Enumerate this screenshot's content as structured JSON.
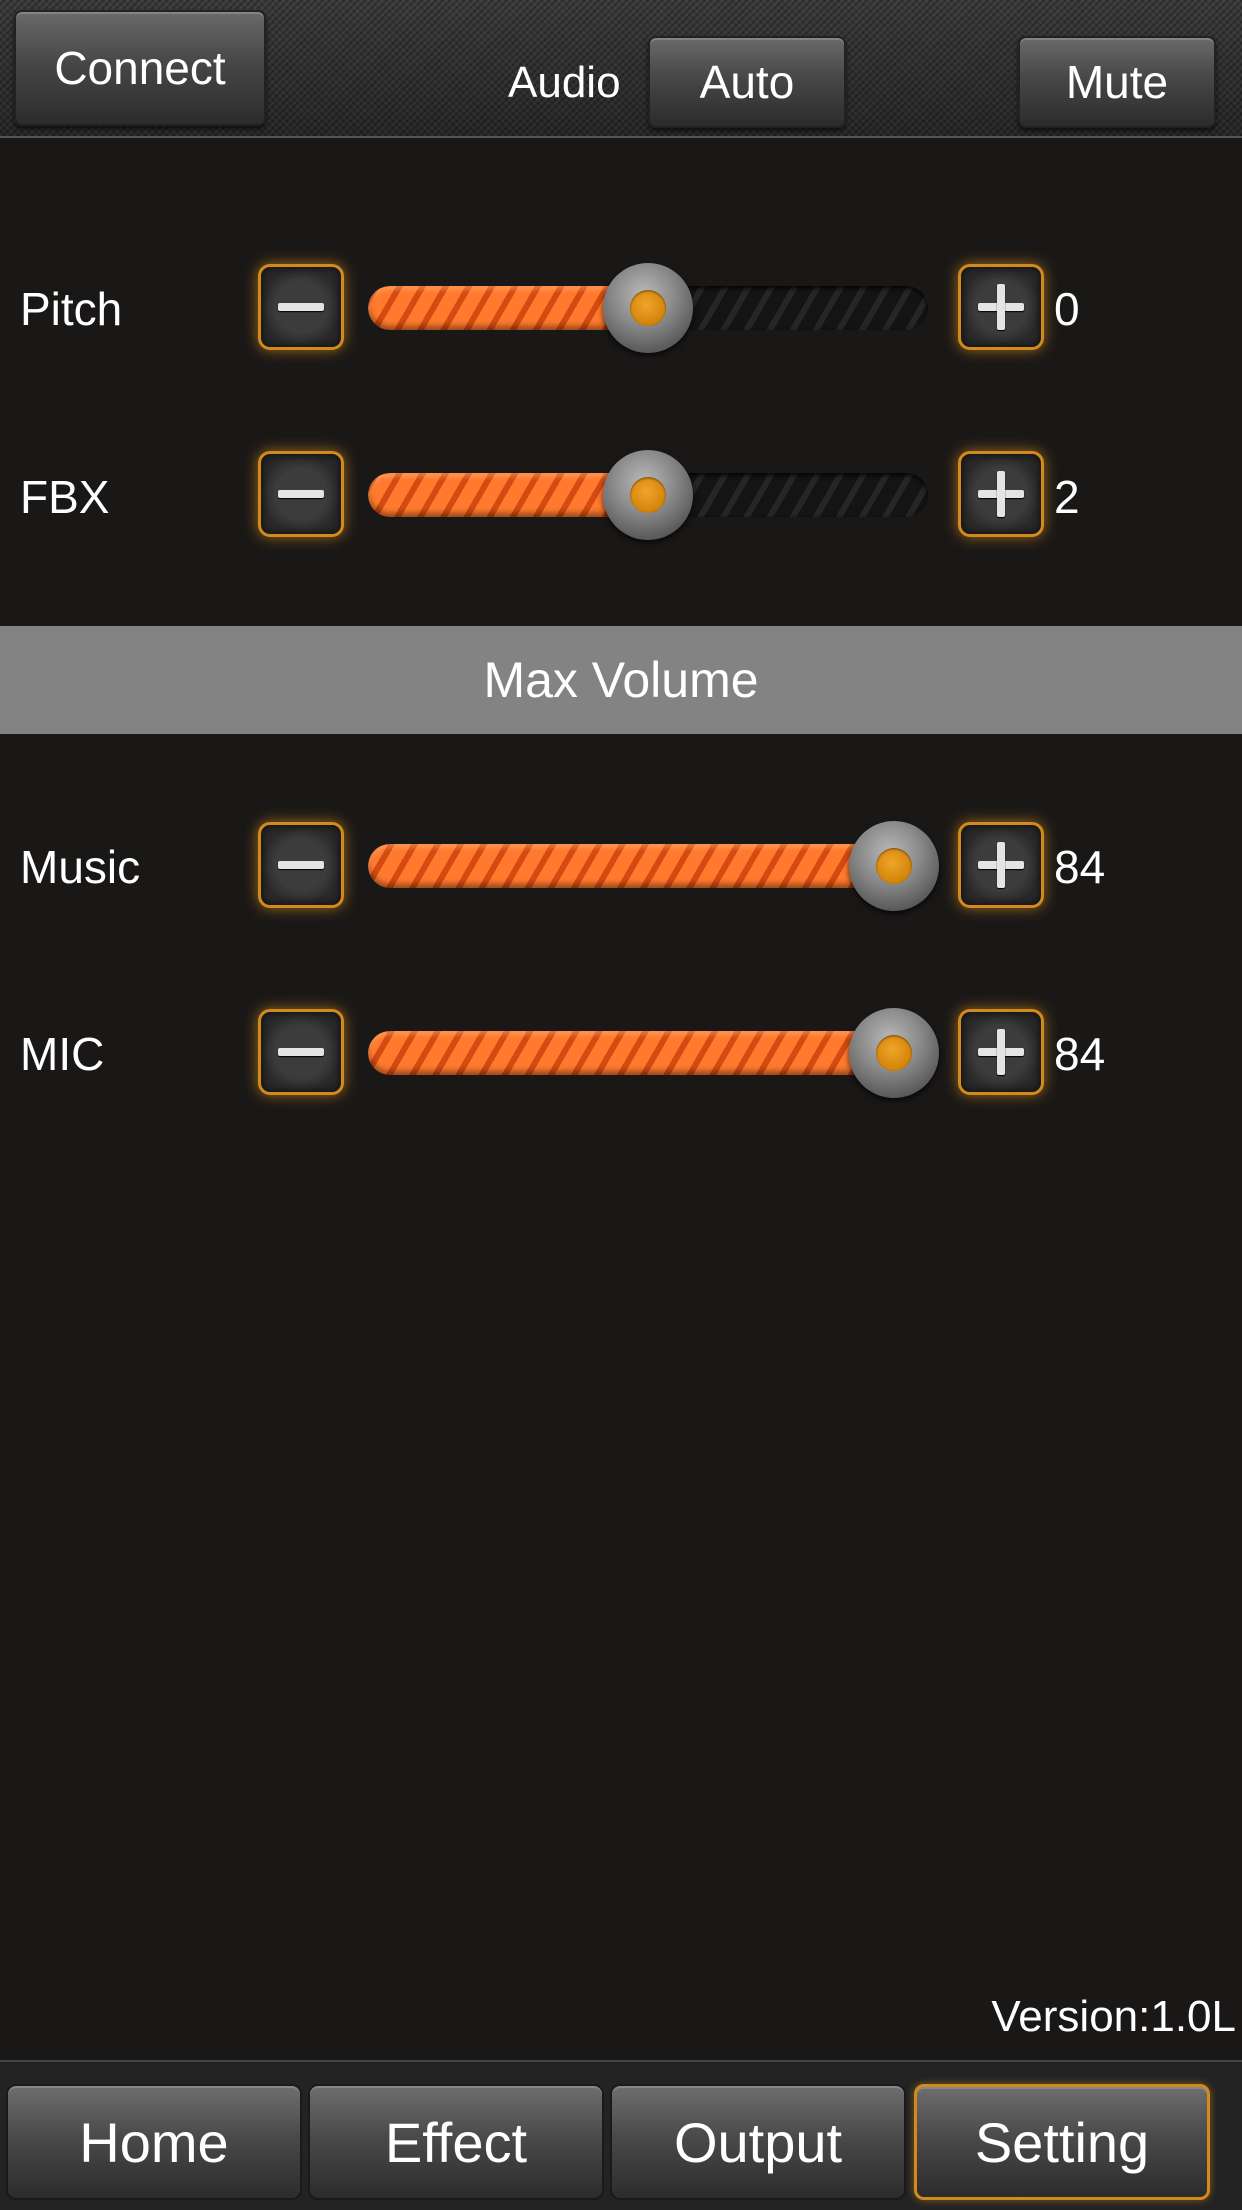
{
  "header": {
    "connect_label": "Connect",
    "audio_label": "Audio",
    "auto_label": "Auto",
    "mute_label": "Mute"
  },
  "controls": [
    {
      "label": "Pitch",
      "value": "0",
      "fill_fraction": 0.5
    },
    {
      "label": "FBX",
      "value": "2",
      "fill_fraction": 0.5
    }
  ],
  "section_title": "Max Volume",
  "volumes": [
    {
      "label": "Music",
      "value": "84",
      "fill_fraction": 0.94
    },
    {
      "label": "MIC",
      "value": "84",
      "fill_fraction": 0.94
    }
  ],
  "version": "Version:1.0L",
  "tabs": [
    {
      "label": "Home",
      "active": false
    },
    {
      "label": "Effect",
      "active": false
    },
    {
      "label": "Output",
      "active": false
    },
    {
      "label": "Setting",
      "active": true
    }
  ],
  "colors": {
    "accent": "#d28a1c",
    "slider_fill": "#ff7a2e",
    "background": "#1a1817",
    "section_band": "#838383"
  },
  "icons": {
    "decrease": "minus-icon",
    "increase": "plus-icon"
  }
}
